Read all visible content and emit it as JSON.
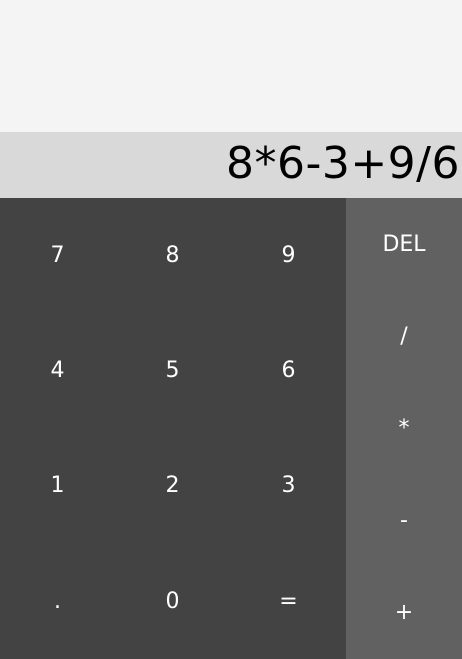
{
  "display": {
    "expression": "8*6-3+9/6"
  },
  "keypad": {
    "keys": [
      "7",
      "8",
      "9",
      "4",
      "5",
      "6",
      "1",
      "2",
      "3",
      ".",
      "0",
      "="
    ]
  },
  "operators": {
    "del": "DEL",
    "divide": "/",
    "multiply": "*",
    "subtract": "-",
    "add": "+"
  },
  "colors": {
    "page_background": "#f4f4f4",
    "display_background": "#d9d9d9",
    "keypad_background": "#434343",
    "operator_background": "#616161",
    "key_text": "#ffffff"
  }
}
